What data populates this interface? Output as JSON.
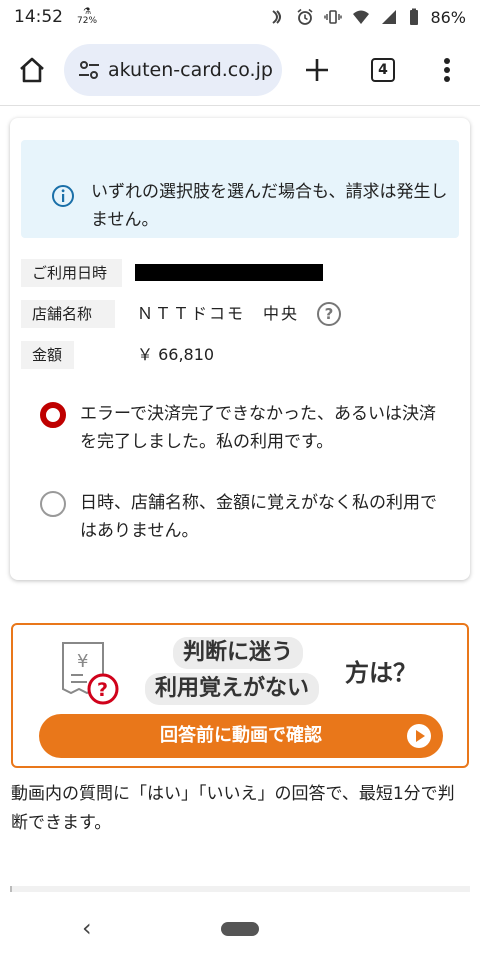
{
  "status_bar": {
    "time": "14:52",
    "small_top": "⚗",
    "small_bottom": "72%",
    "battery": "86%"
  },
  "browser": {
    "url": "akuten-card.co.jp",
    "tab_count": "4"
  },
  "card": {
    "notice": "いずれの選択肢を選んだ場合も、請求は発生しません。",
    "rows": [
      {
        "label": "ご利用日時",
        "value": ""
      },
      {
        "label": "店舗名称",
        "value": "ＮＴＴドコモ　中央"
      },
      {
        "label": "金額",
        "value": "￥ 66,810"
      }
    ],
    "help_icon": "?",
    "options": [
      {
        "text": "エラーで決済完了できなかった、あるいは決済を完了しました。私の利用です。",
        "selected": true
      },
      {
        "text": "日時、店舗名称、金額に覚えがなく私の利用ではありません。",
        "selected": false
      }
    ]
  },
  "banner": {
    "line1": "判断に迷う",
    "line2": "利用覚えがない",
    "tail": "方は？",
    "doc_currency": "¥",
    "button": "回答前に動画で確認"
  },
  "description": "動画内の質問に「はい」「いいえ」の回答で、最短1分で判断できます。",
  "nav": {
    "back": "‹"
  },
  "colors": {
    "accent": "#bf0000",
    "banner_orange": "#e9771a",
    "notice_bg": "#e7f4fb",
    "omnibox_bg": "#e8edf8"
  }
}
